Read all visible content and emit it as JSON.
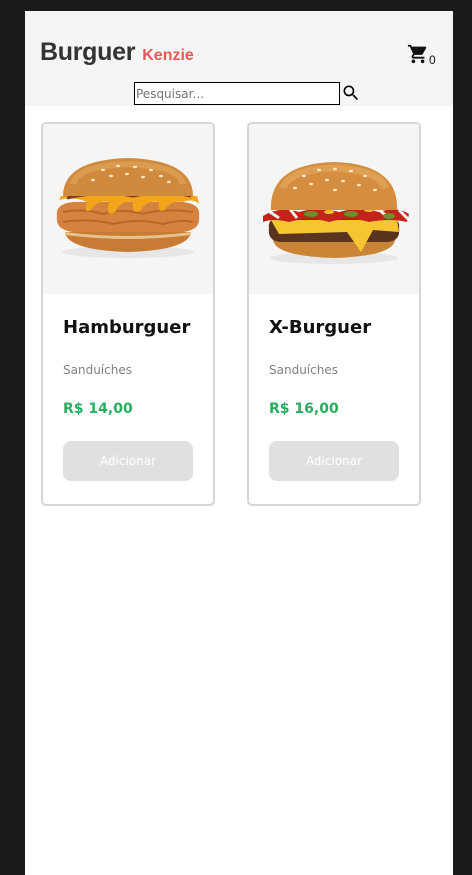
{
  "header": {
    "logo_main": "Burguer",
    "logo_sub": "Kenzie",
    "cart_count": "0"
  },
  "search": {
    "placeholder": "Pesquisar..."
  },
  "products": [
    {
      "name": "Hamburguer",
      "category": "Sanduíches",
      "price": "R$ 14,00",
      "button_label": "Adicionar"
    },
    {
      "name": "X-Burguer",
      "category": "Sanduíches",
      "price": "R$ 16,00",
      "button_label": "Adicionar"
    }
  ],
  "colors": {
    "page_background": "#1b1b1b",
    "header_background": "#f5f5f5",
    "brand_accent": "#eb5757",
    "price": "#27ae60",
    "button_disabled": "#e0e0e0",
    "card_border": "#d6d6d6"
  },
  "icons": {
    "cart": "shopping-cart-icon",
    "search": "magnifier-icon"
  }
}
